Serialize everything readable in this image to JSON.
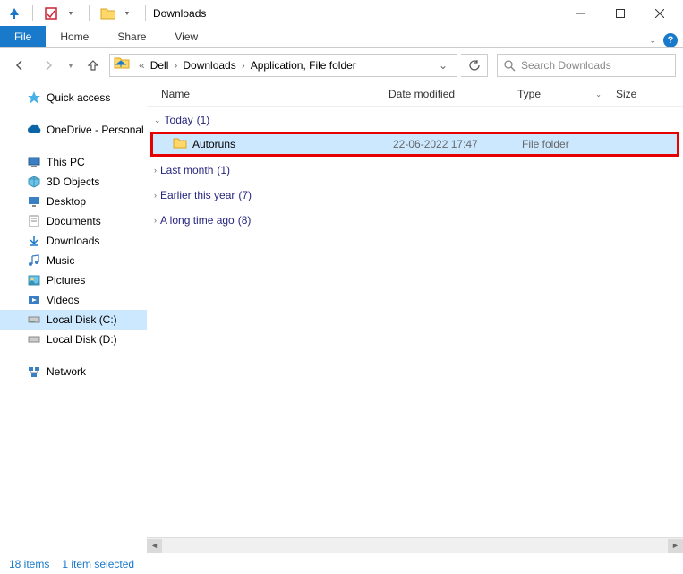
{
  "titlebar": {
    "title": "Downloads"
  },
  "ribbon": {
    "file": "File",
    "tabs": [
      "Home",
      "Share",
      "View"
    ]
  },
  "breadcrumb": {
    "items": [
      "Dell",
      "Downloads",
      "Application, File folder"
    ]
  },
  "search": {
    "placeholder": "Search Downloads"
  },
  "navpane": {
    "quick_access": "Quick access",
    "onedrive": "OneDrive - Personal",
    "this_pc": "This PC",
    "this_pc_items": [
      {
        "icon": "3d",
        "label": "3D Objects"
      },
      {
        "icon": "desktop",
        "label": "Desktop"
      },
      {
        "icon": "documents",
        "label": "Documents"
      },
      {
        "icon": "downloads",
        "label": "Downloads"
      },
      {
        "icon": "music",
        "label": "Music"
      },
      {
        "icon": "pictures",
        "label": "Pictures"
      },
      {
        "icon": "videos",
        "label": "Videos"
      },
      {
        "icon": "disk",
        "label": "Local Disk (C:)"
      },
      {
        "icon": "disk",
        "label": "Local Disk (D:)"
      }
    ],
    "network": "Network"
  },
  "columns": {
    "name": "Name",
    "date": "Date modified",
    "type": "Type",
    "size": "Size"
  },
  "groups": [
    {
      "label": "Today",
      "count": "(1)",
      "expanded": true
    },
    {
      "label": "Last month",
      "count": "(1)",
      "expanded": false
    },
    {
      "label": "Earlier this year",
      "count": "(7)",
      "expanded": false
    },
    {
      "label": "A long time ago",
      "count": "(8)",
      "expanded": false
    }
  ],
  "file_row": {
    "name": "Autoruns",
    "date": "22-06-2022 17:47",
    "type": "File folder"
  },
  "statusbar": {
    "items": "18 items",
    "selected": "1 item selected"
  }
}
